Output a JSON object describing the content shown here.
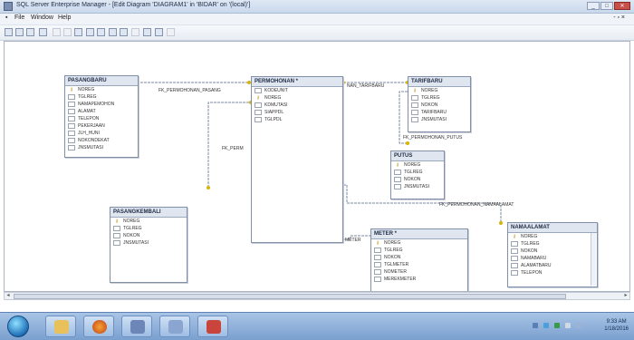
{
  "window": {
    "title": "SQL Server Enterprise Manager - [Edit Diagram 'DIAGRAM1' in 'BIDAR' on '(local)']"
  },
  "menu": {
    "items": [
      "File",
      "Window",
      "Help"
    ]
  },
  "toolbar": {
    "icons": [
      "save-icon",
      "print-icon",
      "copy-icon",
      "new-table-icon",
      "cut-icon",
      "copy2-icon",
      "paste-icon",
      "grid-icon",
      "zoom-icon",
      "properties-icon",
      "key-icon",
      "relationship-icon",
      "layout-icon",
      "arrange-icon",
      "search-icon"
    ]
  },
  "diagram": {
    "tables": {
      "pasangbaru": {
        "name": "PASANGBARU",
        "columns": [
          "NOREG",
          "TGLREG",
          "NAMAPEMOHON",
          "ALAMAT",
          "TELEPON",
          "PEKERJAAN",
          "JLH_HUNI",
          "NOKONDEKAT",
          "JNSMUTASI"
        ]
      },
      "permohonan": {
        "name": "PERMOHONAN *",
        "columns": [
          "KODEUNIT",
          "NOREG",
          "KDMUTASI",
          "SIAPPDL",
          "TGLPDL"
        ]
      },
      "tarifbaru": {
        "name": "TARIFBARU",
        "columns": [
          "NOREG",
          "TGLREG",
          "NOKON",
          "TARIFBARU",
          "JNSMUTASI"
        ]
      },
      "putus": {
        "name": "PUTUS",
        "columns": [
          "NOREG",
          "TGLREG",
          "NOKON",
          "JNSMUTASI"
        ]
      },
      "pasangkembali": {
        "name": "PASANGKEMBALI",
        "columns": [
          "NOREG",
          "TGLREG",
          "NOKON",
          "JNSMUTASI"
        ]
      },
      "meter": {
        "name": "METER *",
        "columns": [
          "NOREG",
          "TGLREG",
          "NOKON",
          "TGLMETER",
          "NOMETER",
          "MEREKMETER"
        ]
      },
      "namaalamat": {
        "name": "NAMAALAMAT",
        "columns": [
          "NOREG",
          "TGLREG",
          "NOKON",
          "NAMABARU",
          "ALAMATBARU",
          "TELEPON"
        ]
      }
    },
    "relationships": {
      "pasangbaru": "FK_PERMOHONAN_PASANG",
      "tarifbaru": "NAN_TARIFBARU",
      "putus": "FK_PERMOHONAN_PUTUS",
      "permohonan_left": "FK_PERM",
      "namaalamat": "FK_PERMOHONAN_NAMAALAMAT",
      "meter": "METER"
    }
  },
  "taskbar": {
    "apps": [
      "explorer-icon",
      "firefox-icon",
      "sql-server-icon",
      "query-analyzer-icon",
      "enterprise-manager-icon"
    ],
    "clock_time": "9:33 AM",
    "clock_date": "1/18/2016"
  },
  "colors": {
    "taskbar": "#7aa0cf",
    "key": "#b98c00",
    "relationship_line": "#7a8aa3"
  }
}
